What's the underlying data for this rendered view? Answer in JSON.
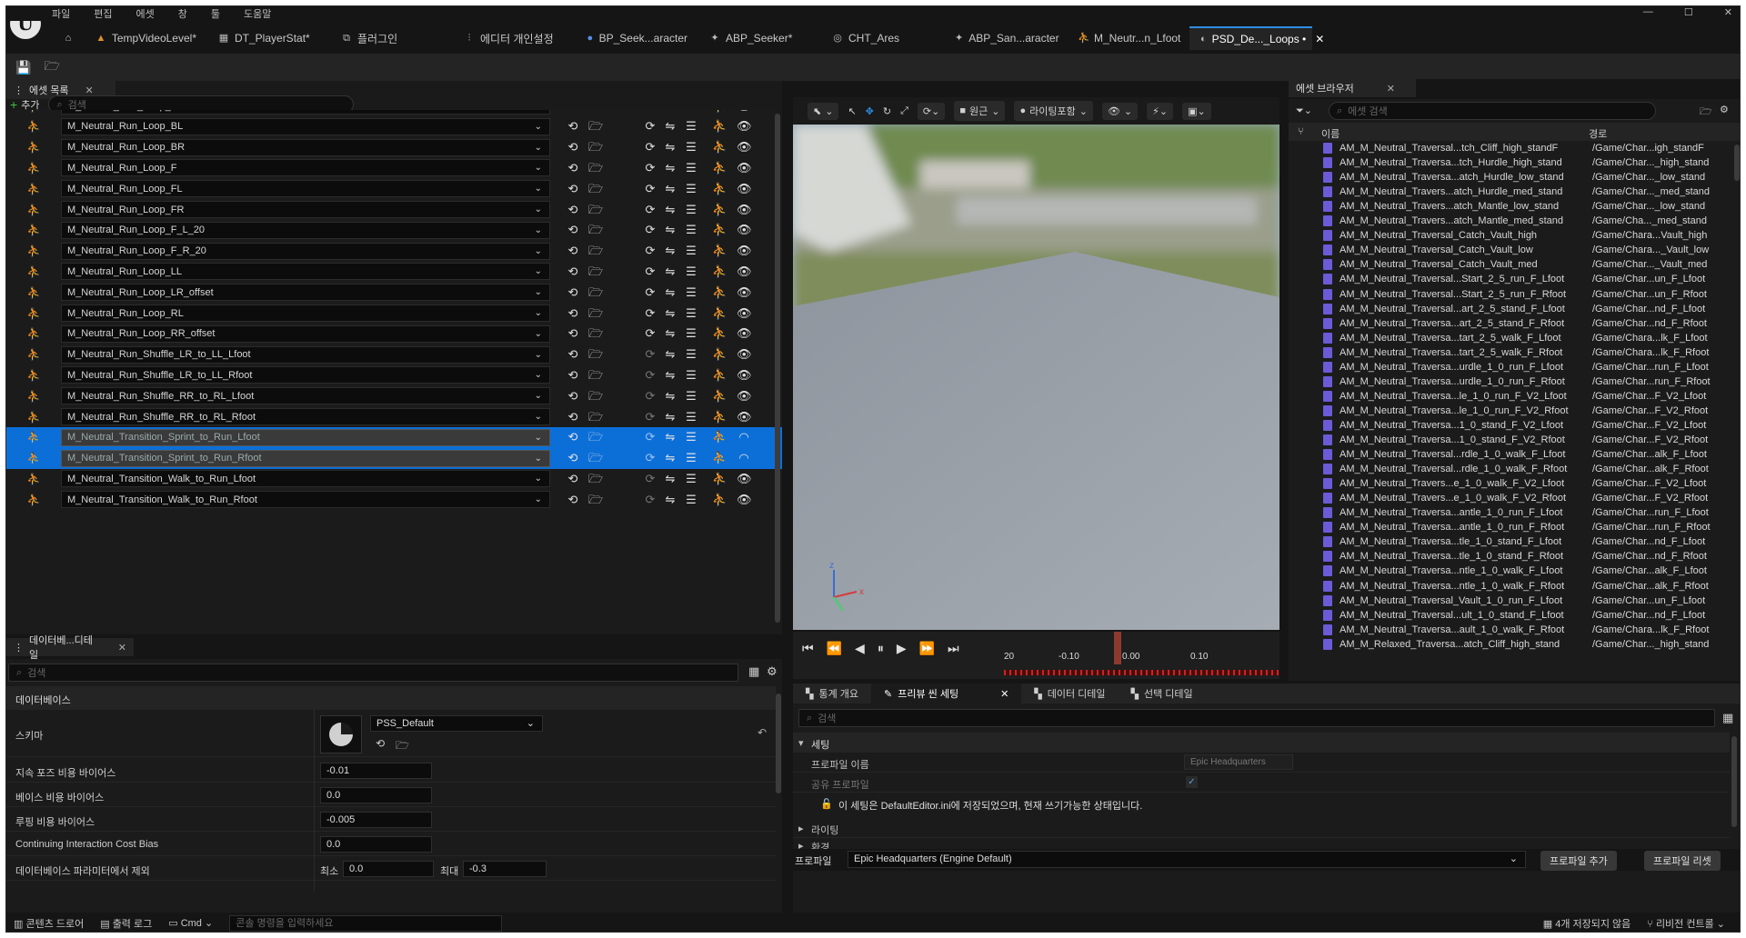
{
  "menu": [
    "파일",
    "편집",
    "에셋",
    "창",
    "툴",
    "도움말"
  ],
  "tabs": [
    {
      "label": "TempVideoLevel*",
      "icon": "level-icon"
    },
    {
      "label": "DT_PlayerStat*",
      "icon": "datatable-icon"
    },
    {
      "label": "플러그인",
      "icon": "plugin-icon"
    },
    {
      "label": "에디터 개인설정",
      "icon": "settings-icon"
    },
    {
      "label": "BP_Seek...aracter",
      "icon": "blueprint-icon"
    },
    {
      "label": "ABP_Seeker*",
      "icon": "animbp-icon"
    },
    {
      "label": "CHT_Ares",
      "icon": "chooser-icon"
    },
    {
      "label": "ABP_San...aracter",
      "icon": "animbp-icon"
    },
    {
      "label": "M_Neutr...n_Lfoot",
      "icon": "anim-icon"
    },
    {
      "label": "PSD_De..._Loops •",
      "icon": "pose-search-icon"
    }
  ],
  "asset_list": {
    "tab": "에셋 목록",
    "add": "추가",
    "search_placeholder": "검색",
    "rows": [
      {
        "name": "M_Neutral_Run_Loop_B",
        "loop": true,
        "selected": false
      },
      {
        "name": "M_Neutral_Run_Loop_BL",
        "loop": true,
        "selected": false
      },
      {
        "name": "M_Neutral_Run_Loop_BR",
        "loop": true,
        "selected": false
      },
      {
        "name": "M_Neutral_Run_Loop_F",
        "loop": true,
        "selected": false
      },
      {
        "name": "M_Neutral_Run_Loop_FL",
        "loop": true,
        "selected": false
      },
      {
        "name": "M_Neutral_Run_Loop_FR",
        "loop": true,
        "selected": false
      },
      {
        "name": "M_Neutral_Run_Loop_F_L_20",
        "loop": true,
        "selected": false
      },
      {
        "name": "M_Neutral_Run_Loop_F_R_20",
        "loop": true,
        "selected": false
      },
      {
        "name": "M_Neutral_Run_Loop_LL",
        "loop": true,
        "selected": false
      },
      {
        "name": "M_Neutral_Run_Loop_LR_offset",
        "loop": true,
        "selected": false
      },
      {
        "name": "M_Neutral_Run_Loop_RL",
        "loop": true,
        "selected": false
      },
      {
        "name": "M_Neutral_Run_Loop_RR_offset",
        "loop": true,
        "selected": false
      },
      {
        "name": "M_Neutral_Run_Shuffle_LR_to_LL_Lfoot",
        "loop": false,
        "selected": false
      },
      {
        "name": "M_Neutral_Run_Shuffle_LR_to_LL_Rfoot",
        "loop": false,
        "selected": false
      },
      {
        "name": "M_Neutral_Run_Shuffle_RR_to_RL_Lfoot",
        "loop": false,
        "selected": false
      },
      {
        "name": "M_Neutral_Run_Shuffle_RR_to_RL_Rfoot",
        "loop": false,
        "selected": false
      },
      {
        "name": "M_Neutral_Transition_Sprint_to_Run_Lfoot",
        "loop": false,
        "selected": true
      },
      {
        "name": "M_Neutral_Transition_Sprint_to_Run_Rfoot",
        "loop": false,
        "selected": true
      },
      {
        "name": "M_Neutral_Transition_Walk_to_Run_Lfoot",
        "loop": false,
        "selected": false
      },
      {
        "name": "M_Neutral_Transition_Walk_to_Run_Rfoot",
        "loop": false,
        "selected": false
      }
    ]
  },
  "details": {
    "tab": "데이터베...디테일",
    "search_placeholder": "검색",
    "section": "데이터베이스",
    "schema_label": "스키마",
    "schema_value": "PSS_Default",
    "fields": [
      {
        "label": "지속 포즈 비용 바이어스",
        "value": "-0.01"
      },
      {
        "label": "베이스 비용 바이어스",
        "value": "0.0"
      },
      {
        "label": "루핑 비용 바이어스",
        "value": "-0.005"
      },
      {
        "label": "Continuing Interaction Cost Bias",
        "value": "0.0"
      }
    ],
    "exclude_label": "데이터베이스 파라미터에서 제외",
    "min_label": "최소",
    "min_value": "0.0",
    "max_label": "최대",
    "max_value": "-0.3"
  },
  "viewport": {
    "perspective": "원근",
    "lighting": "라이팅포함",
    "axis_x": "x",
    "axis_z": "z",
    "timeline": {
      "ticks": [
        "20",
        "-0.10",
        "0.00",
        "0.10"
      ],
      "playhead_fraction": 0.53
    }
  },
  "asset_browser": {
    "tab": "에셋 브라우저",
    "search_placeholder": "에셋 검색",
    "col_name": "이름",
    "col_path": "경로",
    "rows": [
      [
        "AM_M_Neutral_Traversal...tch_Cliff_high_standF",
        "/Game/Char...igh_standF"
      ],
      [
        "AM_M_Neutral_Traversa...tch_Hurdle_high_stand",
        "/Game/Char..._high_stand"
      ],
      [
        "AM_M_Neutral_Traversa...atch_Hurdle_low_stand",
        "/Game/Char..._low_stand"
      ],
      [
        "AM_M_Neutral_Travers...atch_Hurdle_med_stand",
        "/Game/Char..._med_stand"
      ],
      [
        "AM_M_Neutral_Travers...atch_Mantle_low_stand",
        "/Game/Char..._low_stand"
      ],
      [
        "AM_M_Neutral_Travers...atch_Mantle_med_stand",
        "/Game/Cha..._med_stand"
      ],
      [
        "AM_M_Neutral_Traversal_Catch_Vault_high",
        "/Game/Chara...Vault_high"
      ],
      [
        "AM_M_Neutral_Traversal_Catch_Vault_low",
        "/Game/Chara..._Vault_low"
      ],
      [
        "AM_M_Neutral_Traversal_Catch_Vault_med",
        "/Game/Char..._Vault_med"
      ],
      [
        "AM_M_Neutral_Traversal...Start_2_5_run_F_Lfoot",
        "/Game/Char...un_F_Lfoot"
      ],
      [
        "AM_M_Neutral_Traversal...Start_2_5_run_F_Rfoot",
        "/Game/Char...un_F_Rfoot"
      ],
      [
        "AM_M_Neutral_Traversal...art_2_5_stand_F_Lfoot",
        "/Game/Char...nd_F_Lfoot"
      ],
      [
        "AM_M_Neutral_Traversa...art_2_5_stand_F_Rfoot",
        "/Game/Char...nd_F_Rfoot"
      ],
      [
        "AM_M_Neutral_Traversa...tart_2_5_walk_F_Lfoot",
        "/Game/Chara...lk_F_Lfoot"
      ],
      [
        "AM_M_Neutral_Traversa...tart_2_5_walk_F_Rfoot",
        "/Game/Chara...lk_F_Rfoot"
      ],
      [
        "AM_M_Neutral_Traversa...urdle_1_0_run_F_Lfoot",
        "/Game/Char...run_F_Lfoot"
      ],
      [
        "AM_M_Neutral_Traversa...urdle_1_0_run_F_Rfoot",
        "/Game/Char...run_F_Rfoot"
      ],
      [
        "AM_M_Neutral_Traversa...le_1_0_run_F_V2_Lfoot",
        "/Game/Char...F_V2_Lfoot"
      ],
      [
        "AM_M_Neutral_Traversa...le_1_0_run_F_V2_Rfoot",
        "/Game/Char...F_V2_Rfoot"
      ],
      [
        "AM_M_Neutral_Traversa...1_0_stand_F_V2_Lfoot",
        "/Game/Char...F_V2_Lfoot"
      ],
      [
        "AM_M_Neutral_Traversa...1_0_stand_F_V2_Rfoot",
        "/Game/Char...F_V2_Rfoot"
      ],
      [
        "AM_M_Neutral_Traversal...rdle_1_0_walk_F_Lfoot",
        "/Game/Char...alk_F_Lfoot"
      ],
      [
        "AM_M_Neutral_Traversal...rdle_1_0_walk_F_Rfoot",
        "/Game/Char...alk_F_Rfoot"
      ],
      [
        "AM_M_Neutral_Travers...e_1_0_walk_F_V2_Lfoot",
        "/Game/Char...F_V2_Lfoot"
      ],
      [
        "AM_M_Neutral_Travers...e_1_0_walk_F_V2_Rfoot",
        "/Game/Char...F_V2_Rfoot"
      ],
      [
        "AM_M_Neutral_Traversa...antle_1_0_run_F_Lfoot",
        "/Game/Char...run_F_Lfoot"
      ],
      [
        "AM_M_Neutral_Traversa...antle_1_0_run_F_Rfoot",
        "/Game/Char...run_F_Rfoot"
      ],
      [
        "AM_M_Neutral_Traversa...tle_1_0_stand_F_Lfoot",
        "/Game/Char...nd_F_Lfoot"
      ],
      [
        "AM_M_Neutral_Traversa...tle_1_0_stand_F_Rfoot",
        "/Game/Char...nd_F_Rfoot"
      ],
      [
        "AM_M_Neutral_Traversa...ntle_1_0_walk_F_Lfoot",
        "/Game/Char...alk_F_Lfoot"
      ],
      [
        "AM_M_Neutral_Traversa...ntle_1_0_walk_F_Rfoot",
        "/Game/Char...alk_F_Rfoot"
      ],
      [
        "AM_M_Neutral_Traversal_Vault_1_0_run_F_Lfoot",
        "/Game/Char...un_F_Lfoot"
      ],
      [
        "AM_M_Neutral_Traversal...ult_1_0_stand_F_Lfoot",
        "/Game/Char...nd_F_Lfoot"
      ],
      [
        "AM_M_Neutral_Traversa...ault_1_0_walk_F_Rfoot",
        "/Game/Chara...lk_F_Rfoot"
      ],
      [
        "AM_M_Relaxed_Traversa...atch_Cliff_high_stand",
        "/Game/Char..._high_stand"
      ]
    ]
  },
  "bottom_panel": {
    "tabs": [
      "통계 개요",
      "프리뷰 씬 세팅",
      "데이터 디테일",
      "선택 디테일"
    ],
    "search_placeholder": "검색",
    "section_settings": "세팅",
    "profile_name_label": "프로파일 이름",
    "profile_name_value": "Epic Headquarters",
    "shared_profile_label": "공유 프로파일",
    "notice": "이 세팅은 DefaultEditor.ini에 저장되었으며, 현재 쓰기가능한 상태입니다.",
    "section_lighting": "라이팅",
    "section_env": "환경",
    "profile_label": "프로파일",
    "profile_value": "Epic Headquarters (Engine Default)",
    "add_profile": "프로파일 추가",
    "reset_profile": "프로파일 리셋"
  },
  "statusbar": {
    "content_drawer": "콘텐츠 드로어",
    "output_log": "출력 로그",
    "cmd": "Cmd",
    "cmd_placeholder": "콘솔 명령을 입력하세요",
    "unsaved": "4개 저장되지 않음",
    "revision": "리비전 컨트롤"
  },
  "colors": {
    "accent": "#0c6fd8",
    "bg": "#1b1b1b",
    "asset_icon": "#6b5bd6"
  }
}
